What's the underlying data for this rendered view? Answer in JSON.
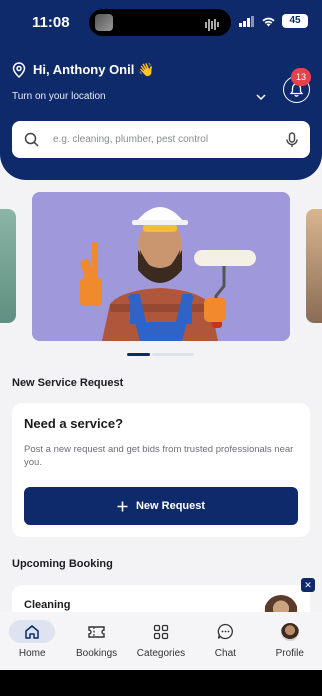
{
  "status_bar": {
    "time": "11:08",
    "battery": "45"
  },
  "header": {
    "greeting": "Hi, Anthony Onil 👋",
    "location_prompt": "Turn on your location",
    "notification_count": "13"
  },
  "search": {
    "placeholder": "e.g. cleaning, plumber, pest control"
  },
  "sections": {
    "new_request_title": "New Service Request",
    "upcoming_title": "Upcoming Booking"
  },
  "service_card": {
    "title": "Need a service?",
    "description": "Post a new request and get bids from trusted professionals near you.",
    "button_label": "New Request"
  },
  "booking": {
    "title": "Cleaning"
  },
  "tabs": [
    {
      "label": "Home",
      "icon": "home-icon",
      "active": true
    },
    {
      "label": "Bookings",
      "icon": "ticket-icon",
      "active": false
    },
    {
      "label": "Categories",
      "icon": "grid-icon",
      "active": false
    },
    {
      "label": "Chat",
      "icon": "chat-icon",
      "active": false
    },
    {
      "label": "Profile",
      "icon": "avatar",
      "active": false
    }
  ],
  "colors": {
    "primary": "#0f2a6b",
    "badge": "#e5424c",
    "background": "#f3f3f5"
  }
}
